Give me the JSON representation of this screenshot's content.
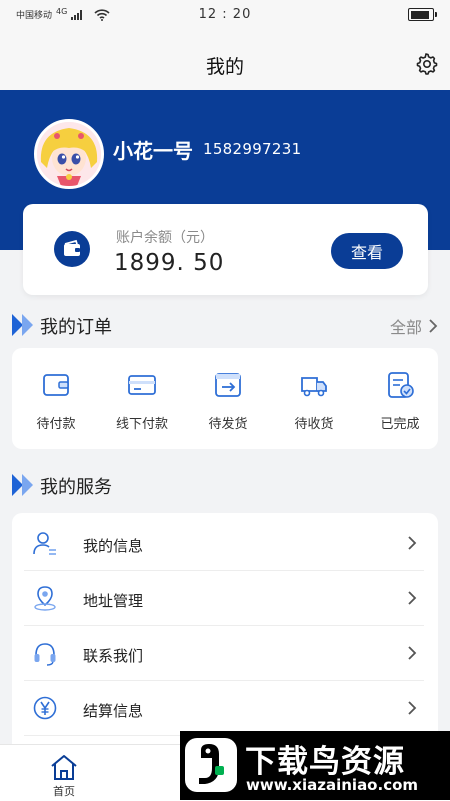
{
  "status_bar": {
    "carrier": "中国移动",
    "network": "4G",
    "time": "12 : 20"
  },
  "header": {
    "title": "我的",
    "settings_icon": "gear-icon"
  },
  "profile": {
    "avatar_icon": "anime-avatar",
    "name": "小花一号",
    "phone": "1582997231"
  },
  "balance": {
    "label": "账户余额（元）",
    "value": "1899. 50",
    "button_label": "查看",
    "icon": "wallet-icon"
  },
  "orders": {
    "title": "我的订单",
    "see_all_label": "全部",
    "items": [
      {
        "label": "待付款",
        "icon": "wallet-icon"
      },
      {
        "label": "线下付款",
        "icon": "card-icon"
      },
      {
        "label": "待发货",
        "icon": "box-arrow-icon"
      },
      {
        "label": "待收货",
        "icon": "truck-icon"
      },
      {
        "label": "已完成",
        "icon": "checklist-icon"
      }
    ]
  },
  "services": {
    "title": "我的服务",
    "items": [
      {
        "label": "我的信息",
        "icon": "user-icon"
      },
      {
        "label": "地址管理",
        "icon": "location-pin-icon"
      },
      {
        "label": "联系我们",
        "icon": "headset-icon"
      },
      {
        "label": "结算信息",
        "icon": "yen-icon"
      }
    ]
  },
  "tab_bar": {
    "home_label": "首页",
    "home_icon": "home-icon"
  },
  "watermark": {
    "title": "下载鸟资源",
    "url": "www.xiazainiao.com"
  },
  "colors": {
    "brand_blue": "#0a3d96",
    "icon_blue": "#2f6fd6",
    "background": "#f2f3f5"
  }
}
